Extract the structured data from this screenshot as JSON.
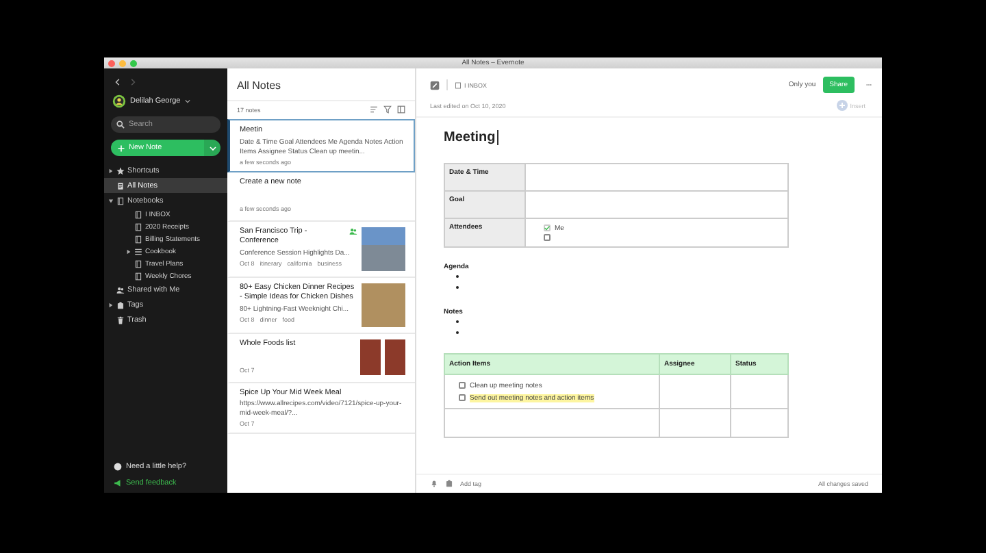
{
  "window": {
    "title": "All Notes – Evernote"
  },
  "sidebar": {
    "user": "Delilah George",
    "search": {
      "placeholder": "Search"
    },
    "new_note": "New Note",
    "items": [
      {
        "label": "Shortcuts",
        "expanded": false,
        "selected": false
      },
      {
        "label": "All Notes",
        "selected": true
      },
      {
        "label": "Notebooks",
        "expanded": true,
        "selected": false,
        "children": [
          {
            "label": "I INBOX",
            "selected": false
          },
          {
            "label": "2020 Receipts",
            "selected": false
          },
          {
            "label": "Billing Statements",
            "selected": false
          },
          {
            "label": "Cookbook",
            "expanded": false,
            "selected": false
          },
          {
            "label": "Travel Plans",
            "selected": false
          },
          {
            "label": "Weekly Chores",
            "selected": false
          }
        ]
      },
      {
        "label": "Shared with Me",
        "selected": false
      },
      {
        "label": "Tags",
        "expanded": false,
        "selected": false
      },
      {
        "label": "Trash",
        "selected": false
      }
    ],
    "help": "Need a little help?",
    "feedback": "Send feedback"
  },
  "note_list": {
    "title": "All Notes",
    "count": "17 notes",
    "notes": [
      {
        "title": "Meetin",
        "snippet": "Date & Time Goal Attendees Me Agenda Notes Action Items Assignee Status Clean up meetin...",
        "date": "a few seconds ago",
        "selected": true
      },
      {
        "title": "Create a new note",
        "date": "a few seconds ago",
        "selected": false
      },
      {
        "title": "San Francisco Trip - Conference",
        "snippet": "Conference Session Highlights Da...",
        "date": "Oct 8",
        "tags": [
          "itinerary",
          "california",
          "business"
        ],
        "shared": true,
        "kind": "photo",
        "selected": false
      },
      {
        "title": "80+ Easy Chicken Dinner Recipes - Simple Ideas for Chicken Dishes",
        "snippet": "80+ Lightning-Fast Weeknight Chi...",
        "date": "Oct 8",
        "tags": [
          "dinner",
          "food"
        ],
        "kind": "photo",
        "selected": false
      },
      {
        "title": "Whole Foods list",
        "date": "Oct 7",
        "kind": "photos",
        "selected": false
      },
      {
        "title": "Spice Up Your Mid Week Meal",
        "snippet": "https://www.allrecipes.com/video/7121/spice-up-your-mid-week-meal/?...",
        "date": "Oct 7",
        "selected": false
      }
    ]
  },
  "editor": {
    "notebook": "I INBOX",
    "sharing": "Only you",
    "share_button": "Share",
    "last_edited": "Last edited on Oct 10, 2020",
    "insert": "Insert",
    "title": "Meeting",
    "info_table": [
      {
        "label": "Date & Time"
      },
      {
        "label": "Goal"
      },
      {
        "label": "Attendees",
        "checklist": [
          {
            "text": "Me",
            "checked": true
          },
          {
            "checked": false
          }
        ]
      }
    ],
    "sections": [
      {
        "heading": "Agenda",
        "bullets": [
          {
            "kind": "empty"
          },
          {
            "kind": "empty"
          }
        ]
      },
      {
        "heading": "Notes",
        "bullets": [
          {
            "kind": "empty"
          },
          {
            "kind": "empty"
          }
        ]
      }
    ],
    "action_table": {
      "columns": [
        "Action Items",
        "Assignee",
        "Status"
      ],
      "rows": [
        {
          "kind": "tasks",
          "tasks": [
            {
              "text": "Clean up meeting notes",
              "checked": false,
              "highlighted": false
            },
            {
              "text": "Send out meeting notes and action items",
              "checked": false,
              "highlighted": true
            }
          ]
        },
        {
          "kind": "blank"
        }
      ]
    },
    "add_tag": "Add tag",
    "status": "All changes saved"
  }
}
